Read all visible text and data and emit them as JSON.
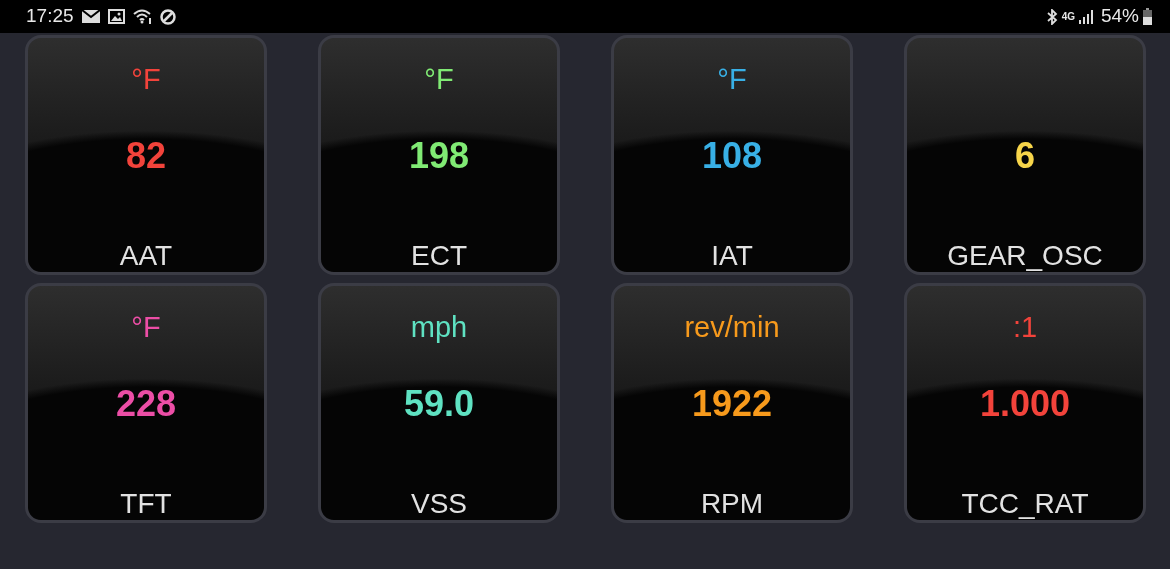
{
  "status_bar": {
    "time": "17:25",
    "network": "4G",
    "battery": "54%"
  },
  "gauges": [
    {
      "unit": "°F",
      "value": "82",
      "label": "AAT",
      "color": "#f2433b"
    },
    {
      "unit": "°F",
      "value": "198",
      "label": "ECT",
      "color": "#80ea74"
    },
    {
      "unit": "°F",
      "value": "108",
      "label": "IAT",
      "color": "#38b0e6"
    },
    {
      "value": "6",
      "label": "GEAR_OSC",
      "color": "#f7d54a"
    },
    {
      "unit": "°F",
      "value": "228",
      "label": "TFT",
      "color": "#ec4ea6"
    },
    {
      "unit": "mph",
      "value": "59.0",
      "label": "VSS",
      "color": "#5fe2c2"
    },
    {
      "unit": "rev/min",
      "value": "1922",
      "label": "RPM",
      "color": "#f79a1c"
    },
    {
      "unit": ":1",
      "value": "1.000",
      "label": "TCC_RAT",
      "color": "#f2433b"
    }
  ]
}
